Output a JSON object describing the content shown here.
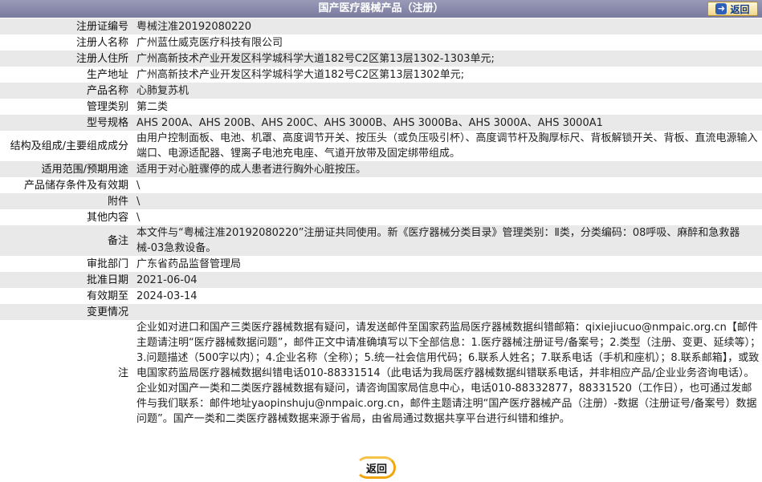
{
  "header": {
    "title": "国产医疗器械产品（注册）",
    "back_label": "返回"
  },
  "rows": [
    {
      "label": "注册证编号",
      "value": "粤械注准20192080220"
    },
    {
      "label": "注册人名称",
      "value": "广州蓝仕威克医疗科技有限公司"
    },
    {
      "label": "注册人住所",
      "value": "广州高新技术产业开发区科学城科学大道182号C2区第13层1302-1303单元;"
    },
    {
      "label": "生产地址",
      "value": "广州高新技术产业开发区科学城科学大道182号C2区第13层1302单元;"
    },
    {
      "label": "产品名称",
      "value": "心肺复苏机"
    },
    {
      "label": "管理类别",
      "value": "第二类"
    },
    {
      "label": "型号规格",
      "value": "AHS 200A、AHS 200B、AHS 200C、AHS 3000B、AHS 3000Ba、AHS 3000A、AHS 3000A1"
    },
    {
      "label": "结构及组成/主要组成成分",
      "value": "由用户控制面板、电池、机罩、高度调节开关、按压头（或负压吸引杯）、高度调节杆及胸厚标尺、背板解锁开关、背板、直流电源输入端口、电源适配器、锂离子电池充电座、气道开放带及固定绑带组成。"
    },
    {
      "label": "适用范围/预期用途",
      "value": "适用于对心脏骤停的成人患者进行胸外心脏按压。"
    },
    {
      "label": "产品储存条件及有效期",
      "value": "\\"
    },
    {
      "label": "附件",
      "value": "\\"
    },
    {
      "label": "其他内容",
      "value": "\\"
    },
    {
      "label": "备注",
      "value": "本文件与“粤械注准20192080220”注册证共同使用。新《医疗器械分类目录》管理类别：Ⅱ类，分类编码：08呼吸、麻醉和急救器械-03急救设备。"
    },
    {
      "label": "审批部门",
      "value": "广东省药品监督管理局"
    },
    {
      "label": "批准日期",
      "value": "2021-06-04"
    },
    {
      "label": "有效期至",
      "value": "2024-03-14"
    },
    {
      "label": "变更情况",
      "value": ""
    }
  ],
  "note": {
    "label": "注",
    "text": "企业如对进口和国产三类医疗器械数据有疑问，请发送邮件至国家药监局医疗器械数据纠错邮箱：qixiejiucuo@nmpaic.org.cn【邮件主题请注明“医疗器械数据问题”，邮件正文中请准确填写以下全部信息：1.医疗器械注册证号/备案号；2.类型（注册、变更、延续等）；3.问题描述（500字以内）；4.企业名称（全称）；5.统一社会信用代码；6.联系人姓名；7.联系电话（手机和座机）；8.联系邮箱】，或致电国家药监局医疗器械数据纠错电话010-88331514（此电话为我局医疗器械数据纠错联系电话，并非相应产品/企业业务咨询电话）。企业如对国产一类和二类医疗器械数据有疑问，请咨询国家局信息中心，电话010-88332877，88331520（工作日），也可通过发邮件与我们联系：邮件地址yaopinshuju@nmpaic.org.cn，邮件主题请注明“国产医疗器械产品（注册）-数据（注册证号/备案号）数据问题”。国产一类和二类医疗器械数据来源于省局，由省局通过数据共享平台进行纠错和维护。"
  },
  "footer": {
    "back_label": "返回"
  },
  "colors": {
    "header_bg": "#8a8aad",
    "row_shade": "#e9e9e9",
    "notice_text": "#1a3d8c",
    "button_ring": "#f2a60c"
  }
}
